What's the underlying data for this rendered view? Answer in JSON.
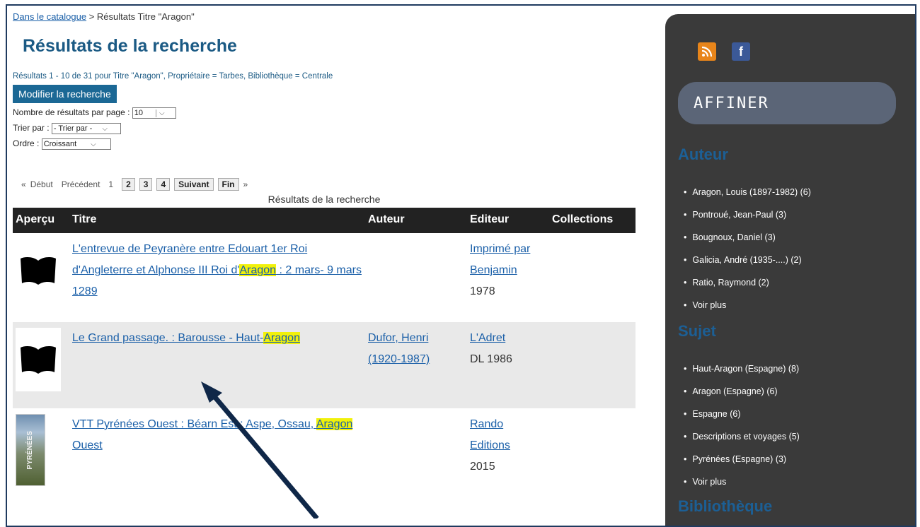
{
  "breadcrumb": {
    "link": "Dans le catalogue",
    "rest": " > Résultats Titre \"Aragon\""
  },
  "title": "Résultats de la recherche",
  "summary": "Résultats 1 - 10 de 31 pour Titre \"Aragon\", Propriétaire = Tarbes, Bibliothèque = Centrale",
  "modify_button": "Modifier la recherche",
  "per_page": {
    "label": "Nombre de résultats par page :",
    "value": "10"
  },
  "sort": {
    "label": "Trier par :",
    "value": "- Trier par -"
  },
  "order": {
    "label": "Ordre :",
    "value": "Croissant"
  },
  "pager": {
    "first": "Début",
    "prev": "Précédent",
    "current": "1",
    "pages": [
      "2",
      "3",
      "4"
    ],
    "next": "Suivant",
    "last": "Fin",
    "lq": "«",
    "rq": "»"
  },
  "caption": "Résultats de la recherche",
  "columns": {
    "preview": "Aperçu",
    "title": "Titre",
    "author": "Auteur",
    "publisher": "Editeur",
    "collections": "Collections"
  },
  "rows": [
    {
      "title_pre": "L'entrevue de Peyranère entre Edouart 1er Roi d'Angleterre et Alphonse III Roi d'",
      "title_hl": "Aragon",
      "title_post": " : 2 mars- 9 mars 1289",
      "author": "",
      "publisher": "Imprimé par Benjamin",
      "year": "1978"
    },
    {
      "title_pre": "Le Grand passage. : Barousse - Haut-",
      "title_hl": "Aragon",
      "title_post": "",
      "author": "Dufor, Henri (1920-1987)",
      "publisher": "L'Adret",
      "year": "DL 1986"
    },
    {
      "title_pre": "VTT Pyrénées Ouest : Béarn Est : Aspe, Ossau, ",
      "title_hl": "Aragon",
      "title_post": " Ouest",
      "author": "",
      "publisher": "Rando Editions",
      "year": "2015",
      "cover_text": "PYRÉNÉES"
    }
  ],
  "sidebar": {
    "refine": "AFFINER",
    "author_title": "Auteur",
    "authors": [
      "Aragon, Louis (1897-1982) (6)",
      "Pontroué, Jean-Paul (3)",
      "Bougnoux, Daniel (3)",
      "Galicia, André (1935-....) (2)",
      "Ratio, Raymond (2)",
      "Voir plus"
    ],
    "subject_title": "Sujet",
    "subjects": [
      "Haut-Aragon (Espagne) (8)",
      "Aragon (Espagne) (6)",
      "Espagne (6)",
      "Descriptions et voyages (5)",
      "Pyrénées (Espagne) (3)",
      "Voir plus"
    ],
    "library_title": "Bibliothèque"
  },
  "icons": {
    "rss": "rss-icon",
    "facebook": "facebook-icon",
    "book": "book-icon"
  },
  "colors": {
    "accent": "#1b5a84",
    "button": "#1b6895",
    "highlight": "#f1f10a",
    "sidebar": "#3a3a3a"
  }
}
